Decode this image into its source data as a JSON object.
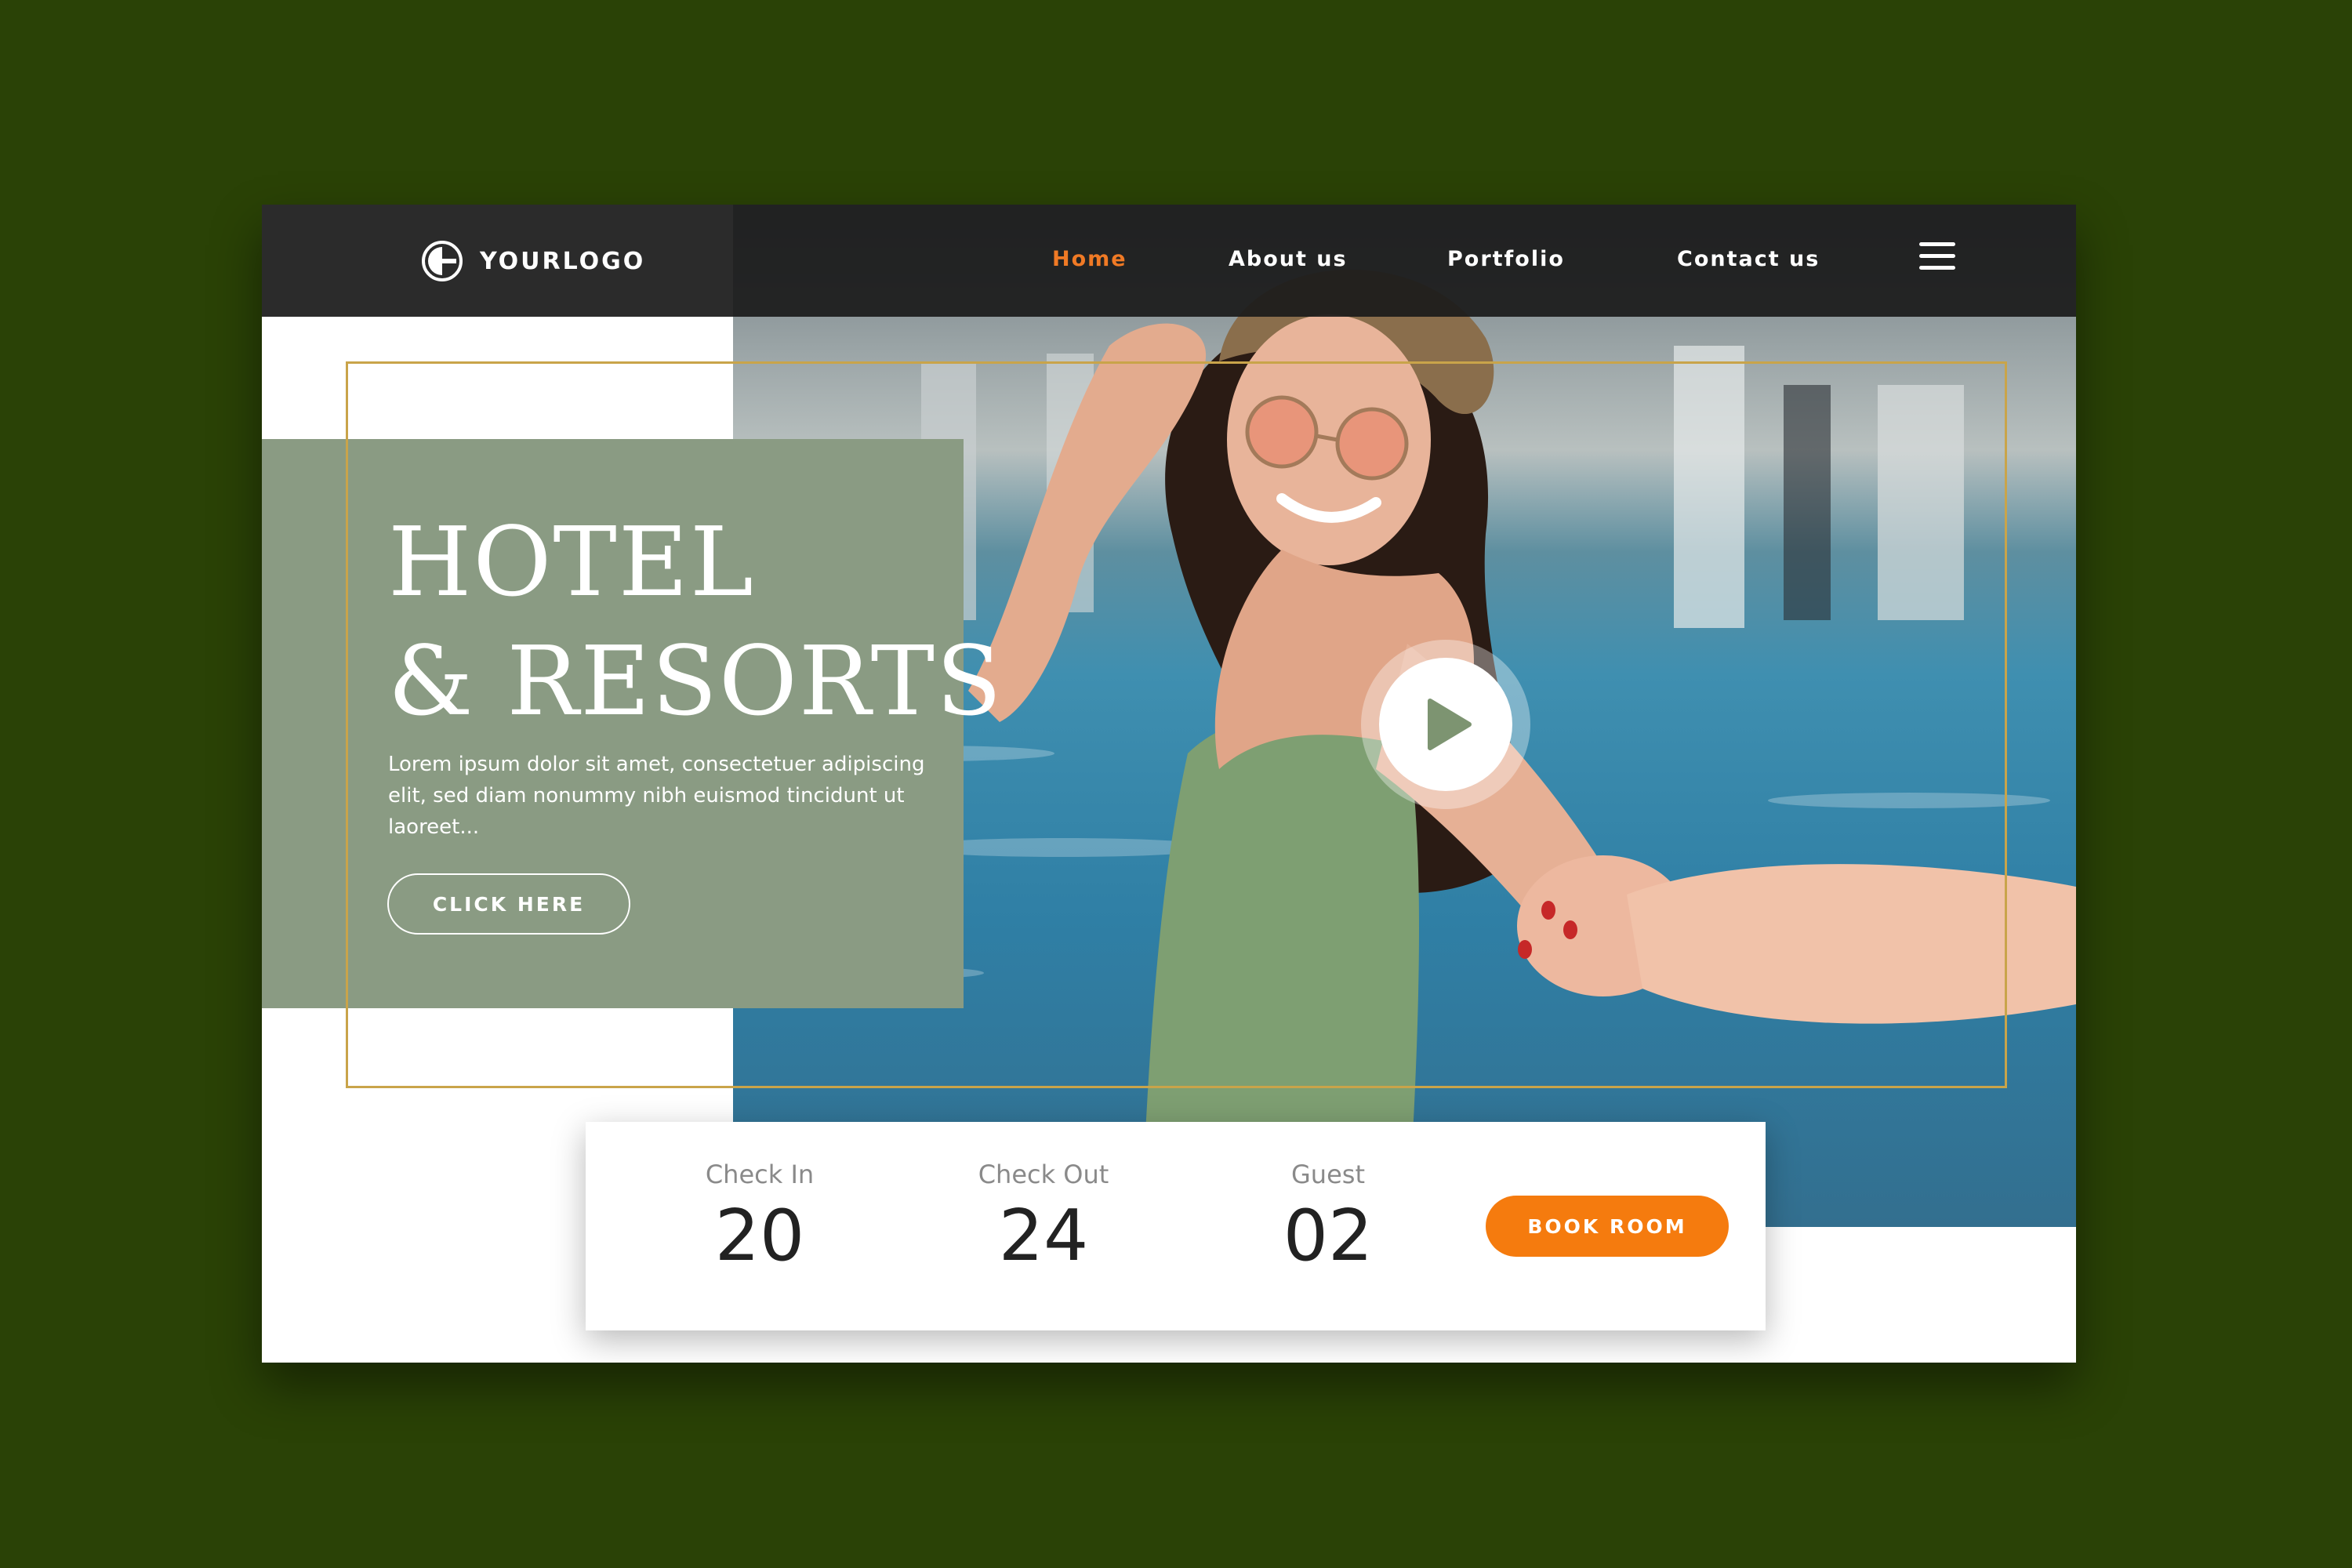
{
  "header": {
    "logo_text": "YOURLOGO",
    "nav": [
      {
        "label": "Home",
        "active": true
      },
      {
        "label": "About us",
        "active": false
      },
      {
        "label": "Portfolio",
        "active": false
      },
      {
        "label": "Contact us",
        "active": false
      }
    ],
    "menu_icon": "hamburger-menu-icon"
  },
  "hero": {
    "title_line1": "HOTEL",
    "title_line2": "& RESORTS",
    "description": "Lorem ipsum dolor sit amet, consectetuer adipiscing elit, sed diam nonummy nibh euismod tincidunt ut laoreet...",
    "cta_label": "CLICK HERE",
    "play_icon": "play-icon"
  },
  "booking": {
    "check_in": {
      "label": "Check In",
      "value": "20"
    },
    "check_out": {
      "label": "Check Out",
      "value": "24"
    },
    "guest": {
      "label": "Guest",
      "value": "02"
    },
    "button_label": "BOOK ROOM"
  },
  "colors": {
    "page_background": "#2a4206",
    "accent_orange": "#f57b0e",
    "nav_active": "#f07a25",
    "panel_green": "#8a9b83",
    "frame_gold": "#c9a44a",
    "header_dark": "#2b2b2b"
  }
}
